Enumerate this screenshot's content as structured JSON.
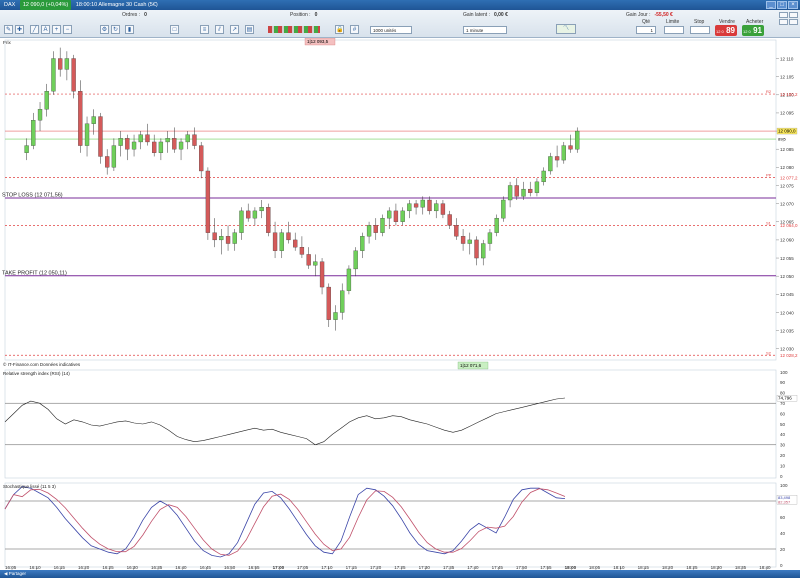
{
  "titlebar": {
    "instrument": "DAX",
    "price_change": "12 090,0 (+0,04%)",
    "datetime_title": "18:00:10 Allemagne 30 Cash (5€)"
  },
  "toolbar": {
    "orders_label": "Ordres :",
    "orders_value": "0",
    "position_label": "Position :",
    "position_value": "0",
    "gain_latent_label": "Gain latent :",
    "gain_latent_value": "0,00 €",
    "gain_jour_label": "Gain Jour :",
    "gain_jour_value": "-55,50 €",
    "qty_label": "Qté",
    "qty_value": "1",
    "limit_label": "Limite",
    "stop_label": "Stop",
    "sell_label": "Vendre",
    "buy_label": "Acheter",
    "sell_price": "89",
    "sell_prefix": "12 0",
    "buy_price": "91",
    "buy_prefix": "12 0",
    "units_select": "1000 unités",
    "interval_select": "1 minute",
    "price_panel_label": "Prix"
  },
  "price_panel": {
    "top_badge": "1|12 093,5",
    "stop_loss_label": "STOP LOSS (12 071,56)",
    "take_profit_label": "TAKE PROFIT (12 050,11)",
    "copyright": "© IT-Finance.com  Données indicatives",
    "bottom_badge": "1|12 071,6",
    "current_price_badge": "12 090,0",
    "current_price_tag": "89|5",
    "level_labels": [
      {
        "name": "R2",
        "value": "12 100,2"
      },
      {
        "name": "PP",
        "value": "12 077,2"
      },
      {
        "name": "S1",
        "value": "12 064,0"
      },
      {
        "name": "S2",
        "value": "12 028,2"
      }
    ],
    "y_ticks": [
      "12 110",
      "12 105",
      "12 100",
      "12 095",
      "12 090",
      "12 085",
      "12 080",
      "12 075",
      "12 070",
      "12 065",
      "12 060",
      "12 055",
      "12 050",
      "12 045",
      "12 040",
      "12 035",
      "12 030"
    ]
  },
  "rsi_panel": {
    "title": "Relative strength index (RSI) (14)",
    "current_value": "74,796",
    "y_ticks": [
      "100",
      "90",
      "80",
      "70",
      "60",
      "50",
      "40",
      "30",
      "20",
      "10",
      "0"
    ]
  },
  "stoch_panel": {
    "title": "Stochastique lissé (11 5 3)",
    "value_k": "83,498",
    "value_d": "82,357",
    "y_ticks": [
      "100",
      "80",
      "60",
      "40",
      "20",
      "0"
    ]
  },
  "x_axis": {
    "ticks": [
      "16:05",
      "16:10",
      "16:15",
      "16:20",
      "16:25",
      "16:30",
      "16:35",
      "16:40",
      "16:45",
      "16:50",
      "16:55",
      "17:00",
      "17:05",
      "17:10",
      "17:15",
      "17:20",
      "17:25",
      "17:30",
      "17:35",
      "17:40",
      "17:45",
      "17:50",
      "17:55",
      "18:00",
      "18:05",
      "18:10",
      "18:15",
      "18:20",
      "18:25",
      "18:30",
      "18:35",
      "18:40"
    ]
  },
  "bottom_bar": {
    "share_label": "Partager"
  },
  "colors": {
    "up": "#6fcf5a",
    "down": "#d45a5a",
    "stop_line": "#7a2c9a",
    "resistance": "#e04040",
    "accent": "#1f5595"
  },
  "chart_data": {
    "type": "candlestick",
    "instrument": "DAX",
    "interval": "1 minute",
    "ylim": [
      12028,
      12114
    ],
    "candles_ohlc": [
      [
        12084,
        12088,
        12082,
        12086
      ],
      [
        12086,
        12095,
        12085,
        12093
      ],
      [
        12093,
        12098,
        12090,
        12096
      ],
      [
        12096,
        12103,
        12094,
        12101
      ],
      [
        12101,
        12112,
        12100,
        12110
      ],
      [
        12110,
        12113,
        12105,
        12107
      ],
      [
        12107,
        12112,
        12104,
        12110
      ],
      [
        12110,
        12111,
        12099,
        12101
      ],
      [
        12101,
        12104,
        12084,
        12086
      ],
      [
        12086,
        12094,
        12083,
        12092
      ],
      [
        12092,
        12096,
        12089,
        12094
      ],
      [
        12094,
        12095,
        12081,
        12083
      ],
      [
        12083,
        12085,
        12078,
        12080
      ],
      [
        12080,
        12088,
        12079,
        12086
      ],
      [
        12086,
        12090,
        12083,
        12088
      ],
      [
        12088,
        12089,
        12082,
        12085
      ],
      [
        12085,
        12089,
        12083,
        12087
      ],
      [
        12087,
        12090,
        12085,
        12089
      ],
      [
        12089,
        12092,
        12086,
        12087
      ],
      [
        12087,
        12089,
        12083,
        12084
      ],
      [
        12084,
        12088,
        12082,
        12087
      ],
      [
        12087,
        12090,
        12084,
        12088
      ],
      [
        12088,
        12091,
        12084,
        12085
      ],
      [
        12085,
        12088,
        12082,
        12087
      ],
      [
        12087,
        12090,
        12085,
        12089
      ],
      [
        12089,
        12091,
        12085,
        12086
      ],
      [
        12086,
        12087,
        12077,
        12079
      ],
      [
        12079,
        12080,
        12060,
        12062
      ],
      [
        12062,
        12066,
        12058,
        12060
      ],
      [
        12060,
        12063,
        12056,
        12061
      ],
      [
        12061,
        12064,
        12057,
        12059
      ],
      [
        12059,
        12063,
        12057,
        12062
      ],
      [
        12062,
        12069,
        12060,
        12068
      ],
      [
        12068,
        12070,
        12065,
        12066
      ],
      [
        12066,
        12069,
        12064,
        12068
      ],
      [
        12068,
        12071,
        12066,
        12069
      ],
      [
        12069,
        12070,
        12061,
        12062
      ],
      [
        12062,
        12065,
        12055,
        12057
      ],
      [
        12057,
        12063,
        12055,
        12062
      ],
      [
        12062,
        12065,
        12059,
        12060
      ],
      [
        12060,
        12062,
        12057,
        12058
      ],
      [
        12058,
        12061,
        12055,
        12056
      ],
      [
        12056,
        12058,
        12052,
        12053
      ],
      [
        12053,
        12056,
        12050,
        12054
      ],
      [
        12054,
        12055,
        12045,
        12047
      ],
      [
        12047,
        12048,
        12036,
        12038
      ],
      [
        12038,
        12042,
        12035,
        12040
      ],
      [
        12040,
        12048,
        12038,
        12046
      ],
      [
        12046,
        12053,
        12045,
        12052
      ],
      [
        12052,
        12058,
        12050,
        12057
      ],
      [
        12057,
        12062,
        12055,
        12061
      ],
      [
        12061,
        12065,
        12059,
        12064
      ],
      [
        12064,
        12066,
        12060,
        12062
      ],
      [
        12062,
        12067,
        12061,
        12066
      ],
      [
        12066,
        12069,
        12063,
        12068
      ],
      [
        12068,
        12070,
        12064,
        12065
      ],
      [
        12065,
        12069,
        12064,
        12068
      ],
      [
        12068,
        12071,
        12066,
        12070
      ],
      [
        12070,
        12071,
        12067,
        12069
      ],
      [
        12069,
        12072,
        12067,
        12071
      ],
      [
        12071,
        12072,
        12067,
        12068
      ],
      [
        12068,
        12071,
        12066,
        12070
      ],
      [
        12070,
        12071,
        12066,
        12067
      ],
      [
        12067,
        12068,
        12063,
        12064
      ],
      [
        12064,
        12066,
        12060,
        12061
      ],
      [
        12061,
        12063,
        12057,
        12059
      ],
      [
        12059,
        12062,
        12056,
        12060
      ],
      [
        12060,
        12061,
        12053,
        12055
      ],
      [
        12055,
        12060,
        12053,
        12059
      ],
      [
        12059,
        12063,
        12057,
        12062
      ],
      [
        12062,
        12067,
        12061,
        12066
      ],
      [
        12066,
        12072,
        12065,
        12071
      ],
      [
        12071,
        12076,
        12069,
        12075
      ],
      [
        12075,
        12077,
        12071,
        12072
      ],
      [
        12072,
        12076,
        12071,
        12074
      ],
      [
        12074,
        12076,
        12072,
        12073
      ],
      [
        12073,
        12077,
        12072,
        12076
      ],
      [
        12076,
        12080,
        12075,
        12079
      ],
      [
        12079,
        12084,
        12078,
        12083
      ],
      [
        12083,
        12086,
        12080,
        12082
      ],
      [
        12082,
        12087,
        12081,
        12086
      ],
      [
        12086,
        12089,
        12084,
        12085
      ],
      [
        12085,
        12091,
        12084,
        12090
      ]
    ],
    "stop_loss": 12071.56,
    "take_profit": 12050.11,
    "rsi": [
      52,
      60,
      68,
      72,
      70,
      64,
      55,
      50,
      54,
      52,
      49,
      48,
      50,
      52,
      53,
      51,
      50,
      52,
      49,
      44,
      38,
      35,
      33,
      34,
      36,
      38,
      40,
      42,
      44,
      46,
      44,
      45,
      42,
      40,
      38,
      36,
      30,
      33,
      40,
      46,
      52,
      56,
      58,
      55,
      56,
      58,
      57,
      54,
      52,
      50,
      47,
      44,
      42,
      44,
      48,
      52,
      56,
      60,
      62,
      64,
      66,
      68,
      70,
      72,
      74,
      75
    ],
    "stochastic_k": [
      70,
      88,
      98,
      96,
      90,
      84,
      72,
      58,
      46,
      34,
      24,
      20,
      16,
      14,
      20,
      36,
      56,
      72,
      80,
      74,
      62,
      46,
      30,
      18,
      12,
      10,
      14,
      28,
      52,
      76,
      90,
      92,
      84,
      70,
      54,
      38,
      24,
      16,
      14,
      30,
      60,
      88,
      96,
      94,
      86,
      74,
      58,
      40,
      26,
      18,
      16,
      14,
      18,
      30,
      44,
      52,
      46,
      40,
      60,
      82,
      94,
      96,
      96,
      90,
      84,
      83
    ]
  }
}
